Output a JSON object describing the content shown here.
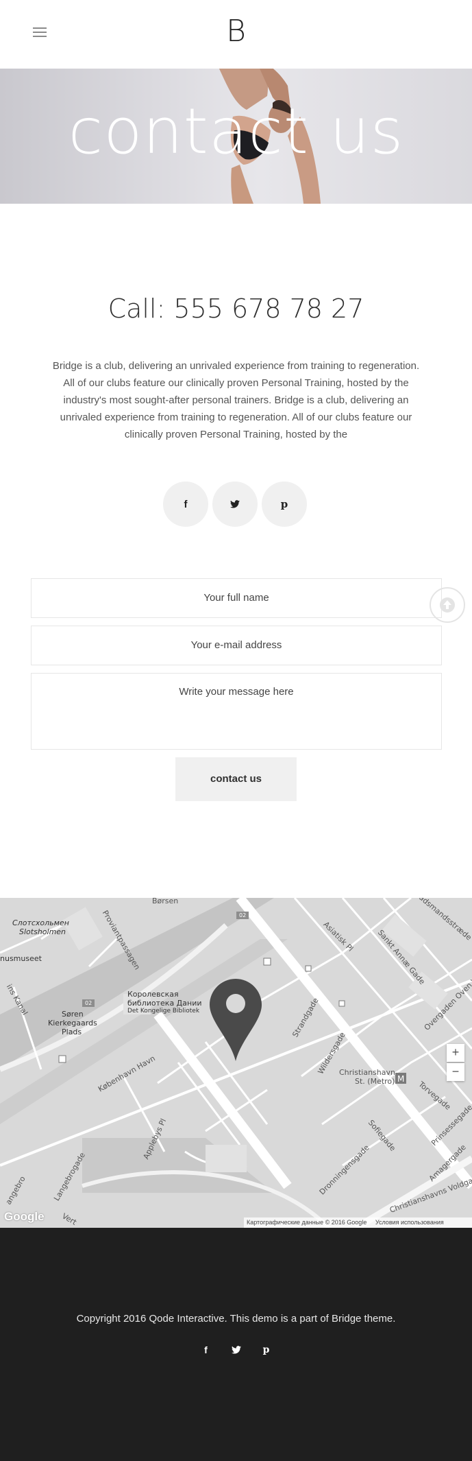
{
  "header": {
    "logo": "B",
    "menu_icon": "hamburger-icon"
  },
  "hero": {
    "title": "contact us"
  },
  "call": "Call: 555 678 78 27",
  "intro": "Bridge is a club, delivering an unrivaled experience from training to regeneration. All of our clubs feature our clinically proven Personal Training, hosted by the industry's most sought-after personal trainers. Bridge is a club, delivering an unrivaled experience from training to regeneration. All of our clubs feature our clinically proven Personal Training, hosted by the",
  "social": [
    {
      "icon": "facebook-icon",
      "glyph": "f"
    },
    {
      "icon": "twitter-icon",
      "glyph": "🐦"
    },
    {
      "icon": "pinterest-icon",
      "glyph": "p"
    }
  ],
  "form": {
    "name_placeholder": "Your full name",
    "email_placeholder": "Your e-mail address",
    "message_placeholder": "Write your message here",
    "submit_label": "contact us"
  },
  "map": {
    "labels": {
      "borsen": "Børsen",
      "slotsholmen_1": "Слотсхольмен",
      "slotsholmen_2": "Slotsholmen",
      "proviantpassagen": "Proviantpassagen",
      "museet": "nusmuseet",
      "kanal": "ins Kanal",
      "soren_1": "Søren",
      "soren_2": "Kierkegaards",
      "soren_3": "Plads",
      "library_1": "Королевская",
      "library_2": "библиотека Дании",
      "library_3": "Det Kongelige Bibliotek",
      "kobenhavns_havn": "København Havn",
      "asiatisk": "Asiatisk Pl",
      "sankt_annae": "Sankt Annæ Gade",
      "sadsmandsstr": "Sadsmandsstræde",
      "overgaden": "Overgaden Oven V",
      "strandgade": "Strandgade",
      "wildersgade": "Wildersgade",
      "christianshavn_1": "Christianshavn",
      "christianshavn_2": "St. (Metro)",
      "torvegade": "Torvegade",
      "prinsessegade": "Prinsessegade",
      "sofiegade": "Sofiegade",
      "dronningensgade": "Dronningensgade",
      "applebys": "Applebys Pl",
      "langebrogade": "Langebrogade",
      "angebro": "angebro",
      "amagergade": "Amagergade",
      "christianshavns_voldgade": "Christianshavns Voldgade",
      "road_02": "02",
      "vert": "Vert"
    },
    "zoom_in": "+",
    "zoom_out": "−",
    "attribution": "Картографические данные © 2016 Google",
    "terms": "Условия использования",
    "google": "Google",
    "marker_icon": "map-pin-icon"
  },
  "footer": {
    "copyright": "Copyright 2016 Qode Interactive. This demo is a part of Bridge theme.",
    "social": [
      "facebook-icon",
      "twitter-icon",
      "pinterest-icon"
    ]
  },
  "colors": {
    "footer_bg": "#1f1f1f",
    "button_bg": "#f0f0f0",
    "marker": "#4a4a4a"
  }
}
